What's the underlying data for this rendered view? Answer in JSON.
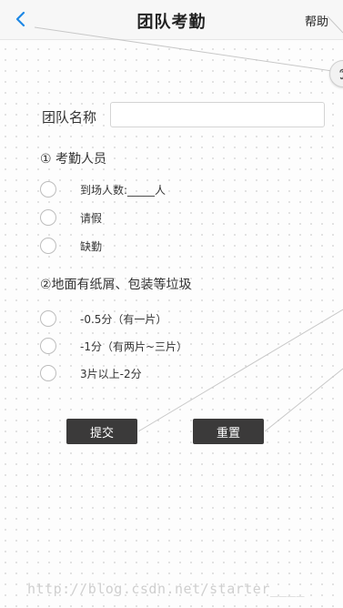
{
  "header": {
    "title": "团队考勤",
    "help": "帮助"
  },
  "form": {
    "team_label": "团队名称",
    "team_value": "",
    "section1": {
      "title": "① 考勤人员",
      "options": [
        {
          "label": "到场人数:_____人"
        },
        {
          "label": "请假"
        },
        {
          "label": "缺勤"
        }
      ]
    },
    "section2": {
      "title": "②地面有纸屑、包装等垃圾",
      "options": [
        {
          "label": " -0.5分（有一片）"
        },
        {
          "label": "-1分（有两片~三片）"
        },
        {
          "label": " 3片以上-2分"
        }
      ]
    },
    "submit": "提交",
    "reset": "重置"
  },
  "watermark": "http://blog.csdn.net/starter____",
  "colors": {
    "accent": "#1e88e5",
    "button_bg": "#3b3a3a"
  },
  "icons": {
    "back": "chevron-left-icon",
    "side": "ear-icon"
  }
}
